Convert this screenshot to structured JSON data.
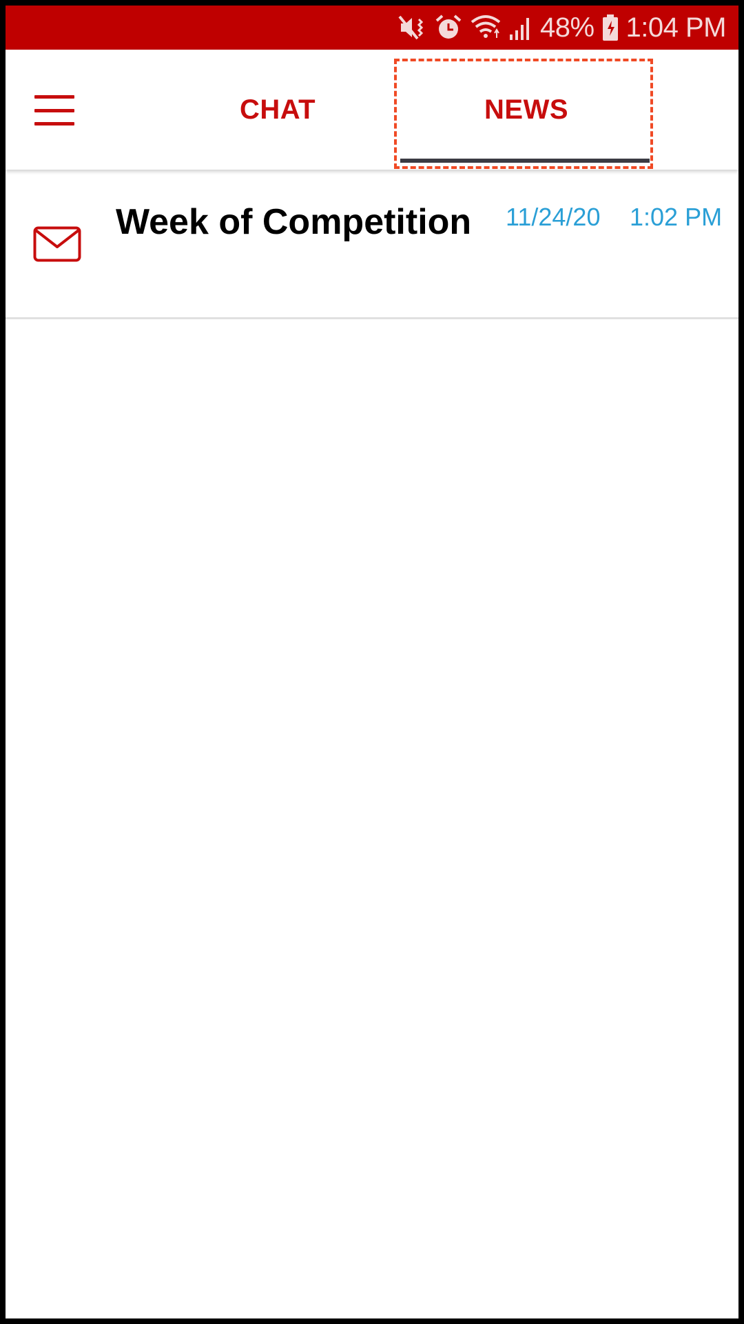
{
  "status_bar": {
    "icons": [
      "mute-vibrate-icon",
      "alarm-icon",
      "wifi-icon",
      "signal-icon",
      "battery-charging-icon"
    ],
    "battery": "48%",
    "time": "1:04 PM",
    "color": "#bf0000"
  },
  "app_bar": {
    "menu_icon": "hamburger-menu-icon",
    "tabs": [
      {
        "label": "CHAT",
        "selected": false
      },
      {
        "label": "NEWS",
        "selected": true
      }
    ],
    "accent_color": "#c70d0d",
    "indicator_color": "#3b3b43"
  },
  "news": {
    "items": [
      {
        "icon": "envelope-icon",
        "title": "Week of Competition",
        "date": "11/24/20",
        "time": "1:02 PM"
      }
    ],
    "date_color": "#2a9fd6"
  }
}
